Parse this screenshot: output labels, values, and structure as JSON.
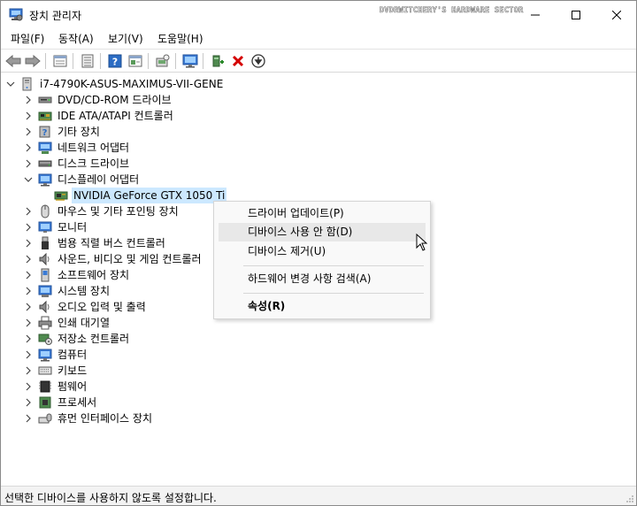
{
  "window": {
    "title": "장치 관리자",
    "watermark": "DVDRWITCHERY'S HARDWARE SECTOR"
  },
  "menu": [
    "파일(F)",
    "동작(A)",
    "보기(V)",
    "도움말(H)"
  ],
  "toolbar": {
    "buttons": [
      "back-arrow-icon",
      "forward-arrow-icon",
      "properties-sheet-icon",
      "list-view-icon",
      "help-icon",
      "action-pane-icon",
      "scan-hardware-icon",
      "monitor-icon",
      "add-driver-icon",
      "uninstall-x-icon",
      "download-arrow-icon"
    ]
  },
  "tree": {
    "root": "i7-4790K-ASUS-MAXIMUS-VII-GENE",
    "categories": [
      {
        "label": "DVD/CD-ROM 드라이브",
        "icon": "dvd-drive-icon",
        "expanded": false
      },
      {
        "label": "IDE ATA/ATAPI 컨트롤러",
        "icon": "ide-controller-icon",
        "expanded": false
      },
      {
        "label": "기타 장치",
        "icon": "unknown-device-icon",
        "expanded": false
      },
      {
        "label": "네트워크 어댑터",
        "icon": "network-adapter-icon",
        "expanded": false
      },
      {
        "label": "디스크 드라이브",
        "icon": "disk-drive-icon",
        "expanded": false
      },
      {
        "label": "디스플레이 어댑터",
        "icon": "display-adapter-icon",
        "expanded": true,
        "children": [
          {
            "label": "NVIDIA GeForce GTX 1050 Ti",
            "icon": "gpu-card-icon",
            "selected": true
          }
        ]
      },
      {
        "label": "마우스 및 기타 포인팅 장치",
        "icon": "mouse-icon",
        "expanded": false
      },
      {
        "label": "모니터",
        "icon": "monitor-icon",
        "expanded": false
      },
      {
        "label": "범용 직렬 버스 컨트롤러",
        "icon": "usb-icon",
        "expanded": false
      },
      {
        "label": "사운드, 비디오 및 게임 컨트롤러",
        "icon": "speaker-icon",
        "expanded": false
      },
      {
        "label": "소프트웨어 장치",
        "icon": "software-device-icon",
        "expanded": false
      },
      {
        "label": "시스템 장치",
        "icon": "system-device-icon",
        "expanded": false
      },
      {
        "label": "오디오 입력 및 출력",
        "icon": "audio-io-icon",
        "expanded": false
      },
      {
        "label": "인쇄 대기열",
        "icon": "printer-icon",
        "expanded": false
      },
      {
        "label": "저장소 컨트롤러",
        "icon": "storage-controller-icon",
        "expanded": false
      },
      {
        "label": "컴퓨터",
        "icon": "computer-icon",
        "expanded": false
      },
      {
        "label": "키보드",
        "icon": "keyboard-icon",
        "expanded": false
      },
      {
        "label": "펌웨어",
        "icon": "firmware-icon",
        "expanded": false
      },
      {
        "label": "프로세서",
        "icon": "processor-icon",
        "expanded": false
      },
      {
        "label": "휴먼 인터페이스 장치",
        "icon": "hid-icon",
        "expanded": false
      }
    ]
  },
  "context_menu": {
    "items": [
      {
        "label": "드라이버 업데이트(P)"
      },
      {
        "label": "디바이스 사용 안 함(D)",
        "hover": true
      },
      {
        "label": "디바이스 제거(U)"
      },
      {
        "label": "하드웨어 변경 사항 검색(A)"
      },
      {
        "label": "속성(R)",
        "bold": true
      }
    ]
  },
  "status": "선택한 디바이스를 사용하지 않도록 설정합니다.",
  "colors": {
    "selection": "#cce8ff",
    "hover": "#e8e8e8",
    "accent_blue": "#2b6cc4",
    "delete_red": "#d40000"
  }
}
